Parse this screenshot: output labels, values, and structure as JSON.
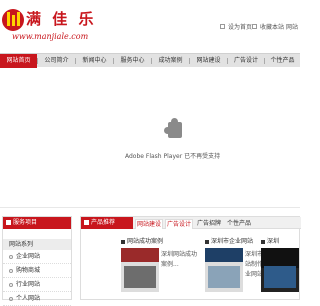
{
  "header": {
    "logo_text": "满 佳 乐",
    "logo_url": "www.manjiale.com",
    "top_links": [
      "设为首页",
      "收藏本站",
      "网站"
    ]
  },
  "nav": {
    "items": [
      {
        "label": "网站首页",
        "active": true
      },
      {
        "label": "公司简介",
        "active": false
      },
      {
        "label": "新闻中心",
        "active": false
      },
      {
        "label": "服务中心",
        "active": false
      },
      {
        "label": "成功案例",
        "active": false
      },
      {
        "label": "网站建设",
        "active": false
      },
      {
        "label": "广告设计",
        "active": false
      },
      {
        "label": "个性产品",
        "active": false
      }
    ]
  },
  "flash": {
    "message": "Adobe Flash Player 已不再受支持"
  },
  "left_box": {
    "title": "服务项目",
    "subheader": "网站系列",
    "items": [
      "企业网站",
      "购物商城",
      "行业网站",
      "个人网站"
    ]
  },
  "products": {
    "title": "产品推荐",
    "tabs": [
      {
        "label": "网站建设",
        "active": true
      },
      {
        "label": "广告设计",
        "active": true
      },
      {
        "label": "广告招牌",
        "active": false
      },
      {
        "label": "个性产品",
        "active": false
      }
    ],
    "cards": [
      {
        "title": "网站成功案例",
        "desc": "深圳网站成功案例..."
      },
      {
        "title": "深圳市企业网站",
        "desc": "深圳市企业网站制作 建立 企业网站建..."
      },
      {
        "title": "深圳",
        "desc": ""
      }
    ]
  },
  "colors": {
    "accent": "#c8161d",
    "nav_bg": "#e2e2e2"
  }
}
